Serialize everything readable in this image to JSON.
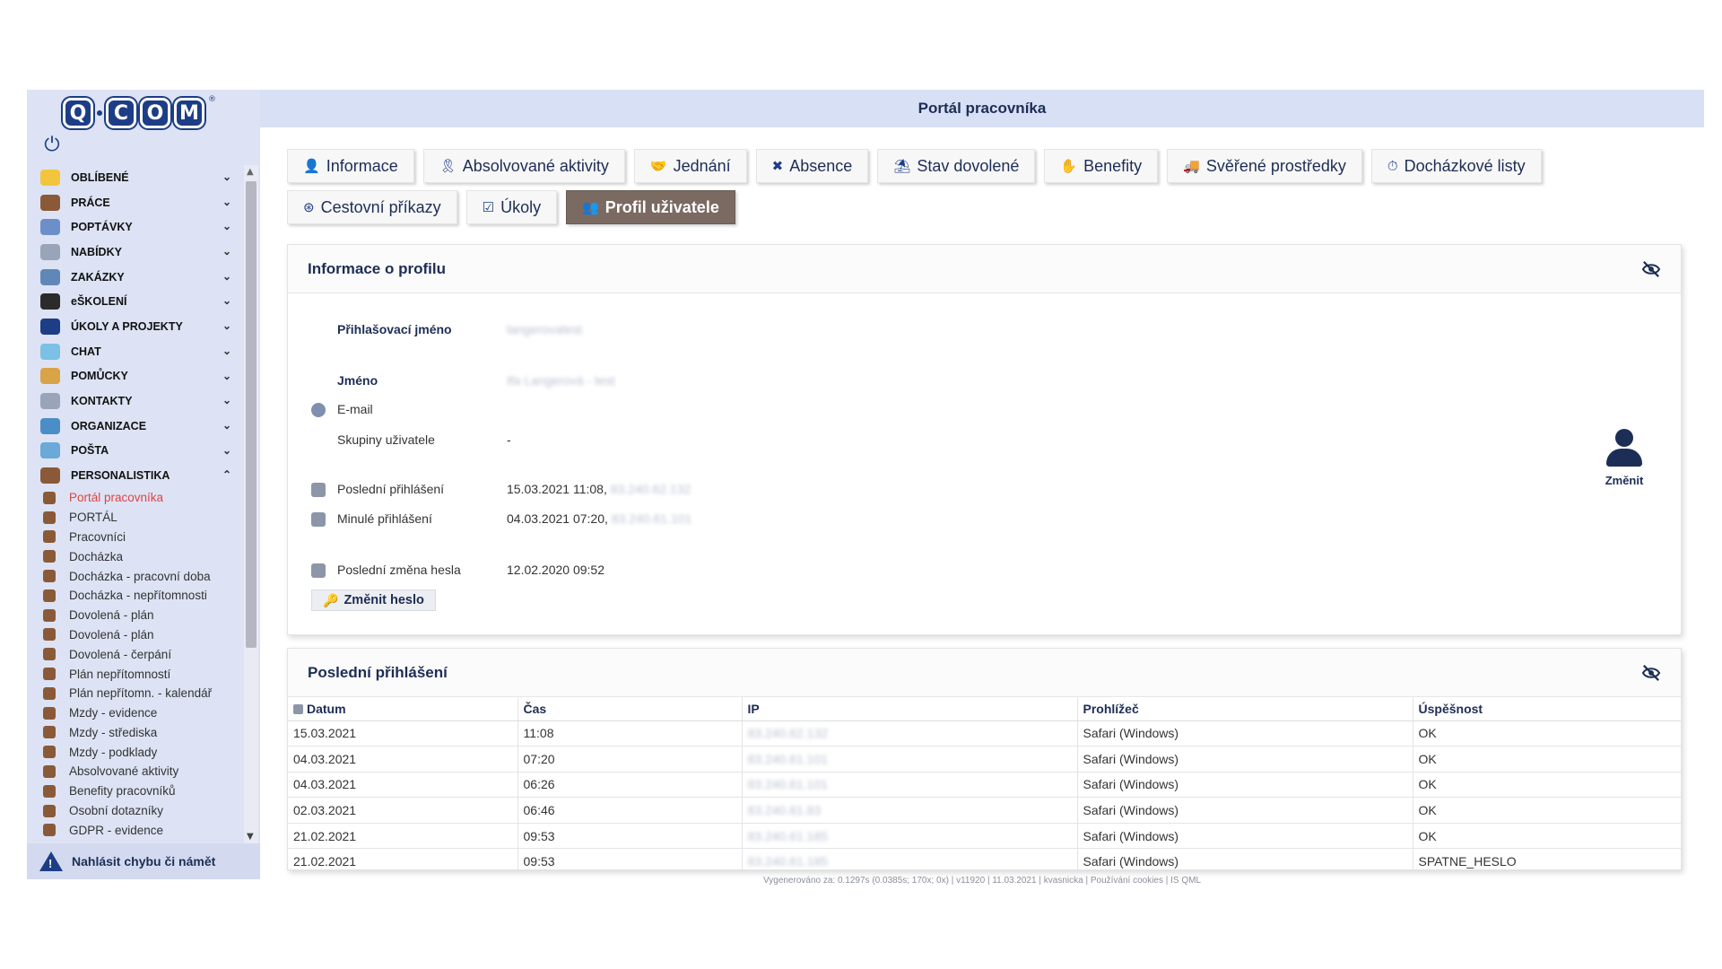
{
  "header": {
    "title": "Portál pracovníka"
  },
  "logo": {
    "letters": [
      "Q",
      "C",
      "O",
      "M"
    ],
    "reg": "®"
  },
  "sidebar": {
    "sections": [
      {
        "label": "OBLÍBENÉ",
        "color": "#f2c53d",
        "expanded": false
      },
      {
        "label": "PRÁCE",
        "color": "#8a5a38",
        "expanded": false
      },
      {
        "label": "POPTÁVKY",
        "color": "#6d8fc9",
        "expanded": false
      },
      {
        "label": "NABÍDKY",
        "color": "#9aa4b8",
        "expanded": false
      },
      {
        "label": "ZAKÁZKY",
        "color": "#5f88b8",
        "expanded": false
      },
      {
        "label": "eŠKOLENÍ",
        "color": "#2b2b2b",
        "expanded": false
      },
      {
        "label": "ÚKOLY A PROJEKTY",
        "color": "#1d3d86",
        "expanded": false
      },
      {
        "label": "CHAT",
        "color": "#7cc0e6",
        "expanded": false
      },
      {
        "label": "POMŮCKY",
        "color": "#d9a347",
        "expanded": false
      },
      {
        "label": "KONTAKTY",
        "color": "#9aa4b8",
        "expanded": false
      },
      {
        "label": "ORGANIZACE",
        "color": "#4b8dc6",
        "expanded": false
      },
      {
        "label": "POŠTA",
        "color": "#6aa9d8",
        "expanded": false
      },
      {
        "label": "PERSONALISTIKA",
        "color": "#8a5a38",
        "expanded": true
      }
    ],
    "sub_items": [
      {
        "label": "Portál pracovníka",
        "active": true
      },
      {
        "label": "PORTÁL"
      },
      {
        "label": "Pracovníci"
      },
      {
        "label": "Docházka"
      },
      {
        "label": "Docházka - pracovní doba"
      },
      {
        "label": "Docházka - nepřítomnosti"
      },
      {
        "label": "Dovolená - plán"
      },
      {
        "label": "Dovolená - plán"
      },
      {
        "label": "Dovolená - čerpání"
      },
      {
        "label": "Plán nepřítomností"
      },
      {
        "label": "Plán nepřítomn. - kalendář"
      },
      {
        "label": "Mzdy - evidence"
      },
      {
        "label": "Mzdy - střediska"
      },
      {
        "label": "Mzdy - podklady"
      },
      {
        "label": "Absolvované aktivity"
      },
      {
        "label": "Benefity pracovníků"
      },
      {
        "label": "Osobní dotazníky"
      },
      {
        "label": "GDPR - evidence"
      }
    ],
    "report_label": "Nahlásit chybu či námět"
  },
  "tabs": [
    [
      {
        "label": "Informace",
        "icon": "user-info-icon",
        "glyph": "👤"
      },
      {
        "label": "Absolvované aktivity",
        "icon": "ribbon-icon",
        "glyph": "🎗"
      },
      {
        "label": "Jednání",
        "icon": "handshake-icon",
        "glyph": "🤝"
      },
      {
        "label": "Absence",
        "icon": "user-slash-icon",
        "glyph": "✖"
      },
      {
        "label": "Stav dovolené",
        "icon": "umbrella-beach-icon",
        "glyph": "⛱"
      },
      {
        "label": "Benefity",
        "icon": "hand-holding-icon",
        "glyph": "✋"
      },
      {
        "label": "Svěřené prostředky",
        "icon": "truck-icon",
        "glyph": "🚚"
      },
      {
        "label": "Docházkové listy",
        "icon": "user-clock-icon",
        "glyph": "⏱"
      }
    ],
    [
      {
        "label": "Cestovní příkazy",
        "icon": "compass-icon",
        "glyph": "⊛"
      },
      {
        "label": "Úkoly",
        "icon": "clipboard-check-icon",
        "glyph": "☑"
      },
      {
        "label": "Profil uživatele",
        "icon": "users-icon",
        "glyph": "👥",
        "active": true
      }
    ]
  ],
  "profile": {
    "title": "Informace o profilu",
    "login_label": "Přihlašovací jméno",
    "login_value": "langerovatest",
    "name_label": "Jméno",
    "name_value": "Ifa Langerová - test",
    "email_label": "E-mail",
    "groups_label": "Skupiny uživatele",
    "groups_value": "-",
    "last_login_label": "Poslední přihlášení",
    "last_login_value": "15.03.2021 11:08,",
    "last_login_ip": "83.240.62.132",
    "prev_login_label": "Minulé přihlášení",
    "prev_login_value": "04.03.2021 07:20,",
    "prev_login_ip": "83.240.61.101",
    "pass_change_label": "Poslední změna hesla",
    "pass_change_value": "12.02.2020 09:52",
    "change_pass_button": "Změnit heslo",
    "avatar_label": "Změnit"
  },
  "logins": {
    "title": "Poslední přihlášení",
    "columns": [
      "Datum",
      "Čas",
      "IP",
      "Prohlížeč",
      "Úspěšnost"
    ],
    "rows": [
      [
        "15.03.2021",
        "11:08",
        "83.240.62.132",
        "Safari (Windows)",
        "OK"
      ],
      [
        "04.03.2021",
        "07:20",
        "83.240.61.101",
        "Safari (Windows)",
        "OK"
      ],
      [
        "04.03.2021",
        "06:26",
        "83.240.61.101",
        "Safari (Windows)",
        "OK"
      ],
      [
        "02.03.2021",
        "06:46",
        "83.240.61.83",
        "Safari (Windows)",
        "OK"
      ],
      [
        "21.02.2021",
        "09:53",
        "83.240.61.185",
        "Safari (Windows)",
        "OK"
      ],
      [
        "21.02.2021",
        "09:53",
        "83.240.61.185",
        "Safari (Windows)",
        "SPATNE_HESLO"
      ]
    ]
  },
  "footer": "Vygenerováno za: 0.1297s (0.0385s; 170x; 0x) | v11920 | 11.03.2021 | kvasnicka | Používání cookies | IS QML"
}
